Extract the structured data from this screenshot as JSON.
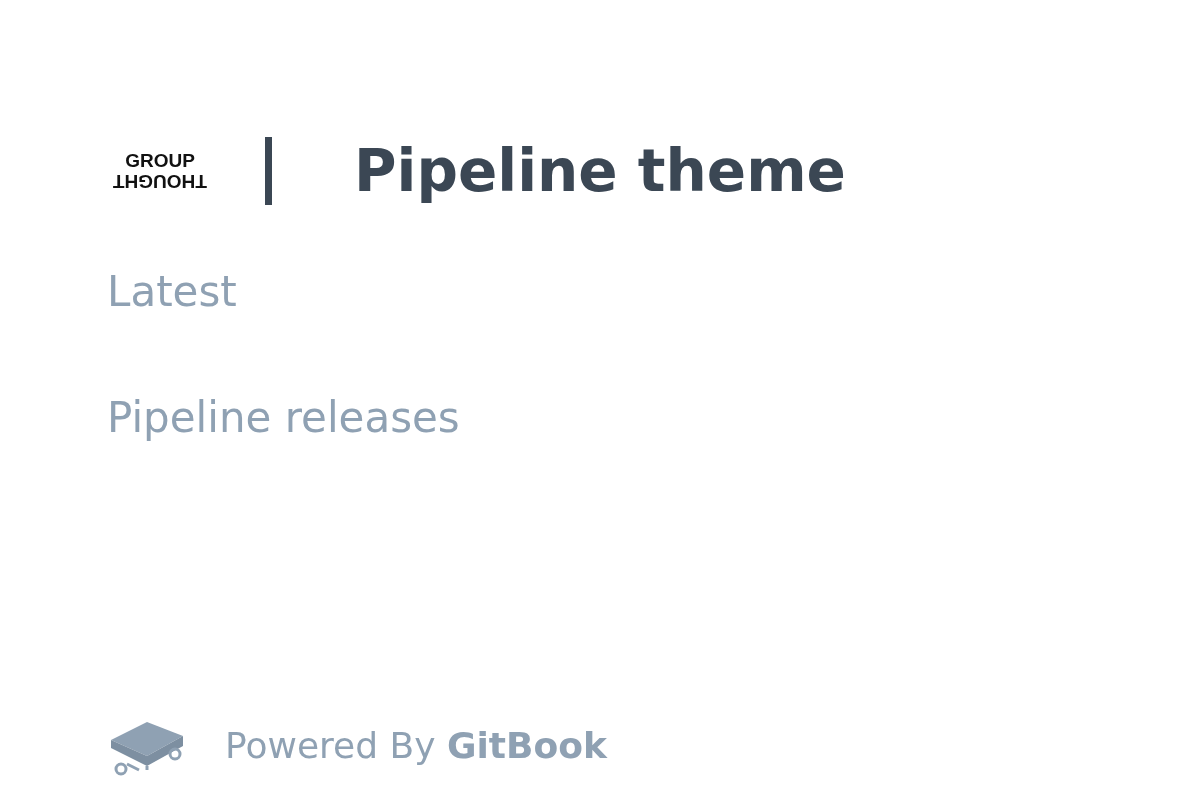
{
  "header": {
    "logo": {
      "top": "GROUP",
      "bottom": "THOUGHT"
    },
    "title": "Pipeline theme"
  },
  "nav": [
    {
      "label": "Latest"
    },
    {
      "label": "Pipeline releases"
    }
  ],
  "footer": {
    "text": "Powered By **GitBook**"
  }
}
